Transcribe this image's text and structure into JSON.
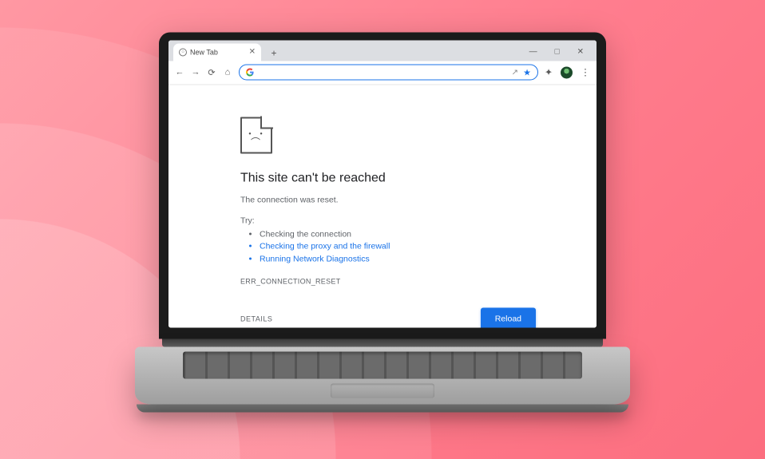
{
  "window": {
    "min": "—",
    "max": "□",
    "close": "✕"
  },
  "tab": {
    "title": "New Tab",
    "close": "✕"
  },
  "newtab": "+",
  "toolbar": {
    "back": "←",
    "forward": "→",
    "reload": "⟳",
    "home": "⌂",
    "share": "↗",
    "ext": "✦",
    "menu": "⋮"
  },
  "omnibox": {
    "placeholder": "",
    "fwd": "↗",
    "star": "★"
  },
  "error": {
    "title": "This site can't be reached",
    "message": "The connection was reset.",
    "try_label": "Try:",
    "suggestions": [
      {
        "text": "Checking the connection",
        "link": false
      },
      {
        "text": "Checking the proxy and the firewall",
        "link": true
      },
      {
        "text": "Running Network Diagnostics",
        "link": true
      }
    ],
    "code": "ERR_CONNECTION_RESET",
    "details": "DETAILS",
    "reload": "Reload"
  }
}
